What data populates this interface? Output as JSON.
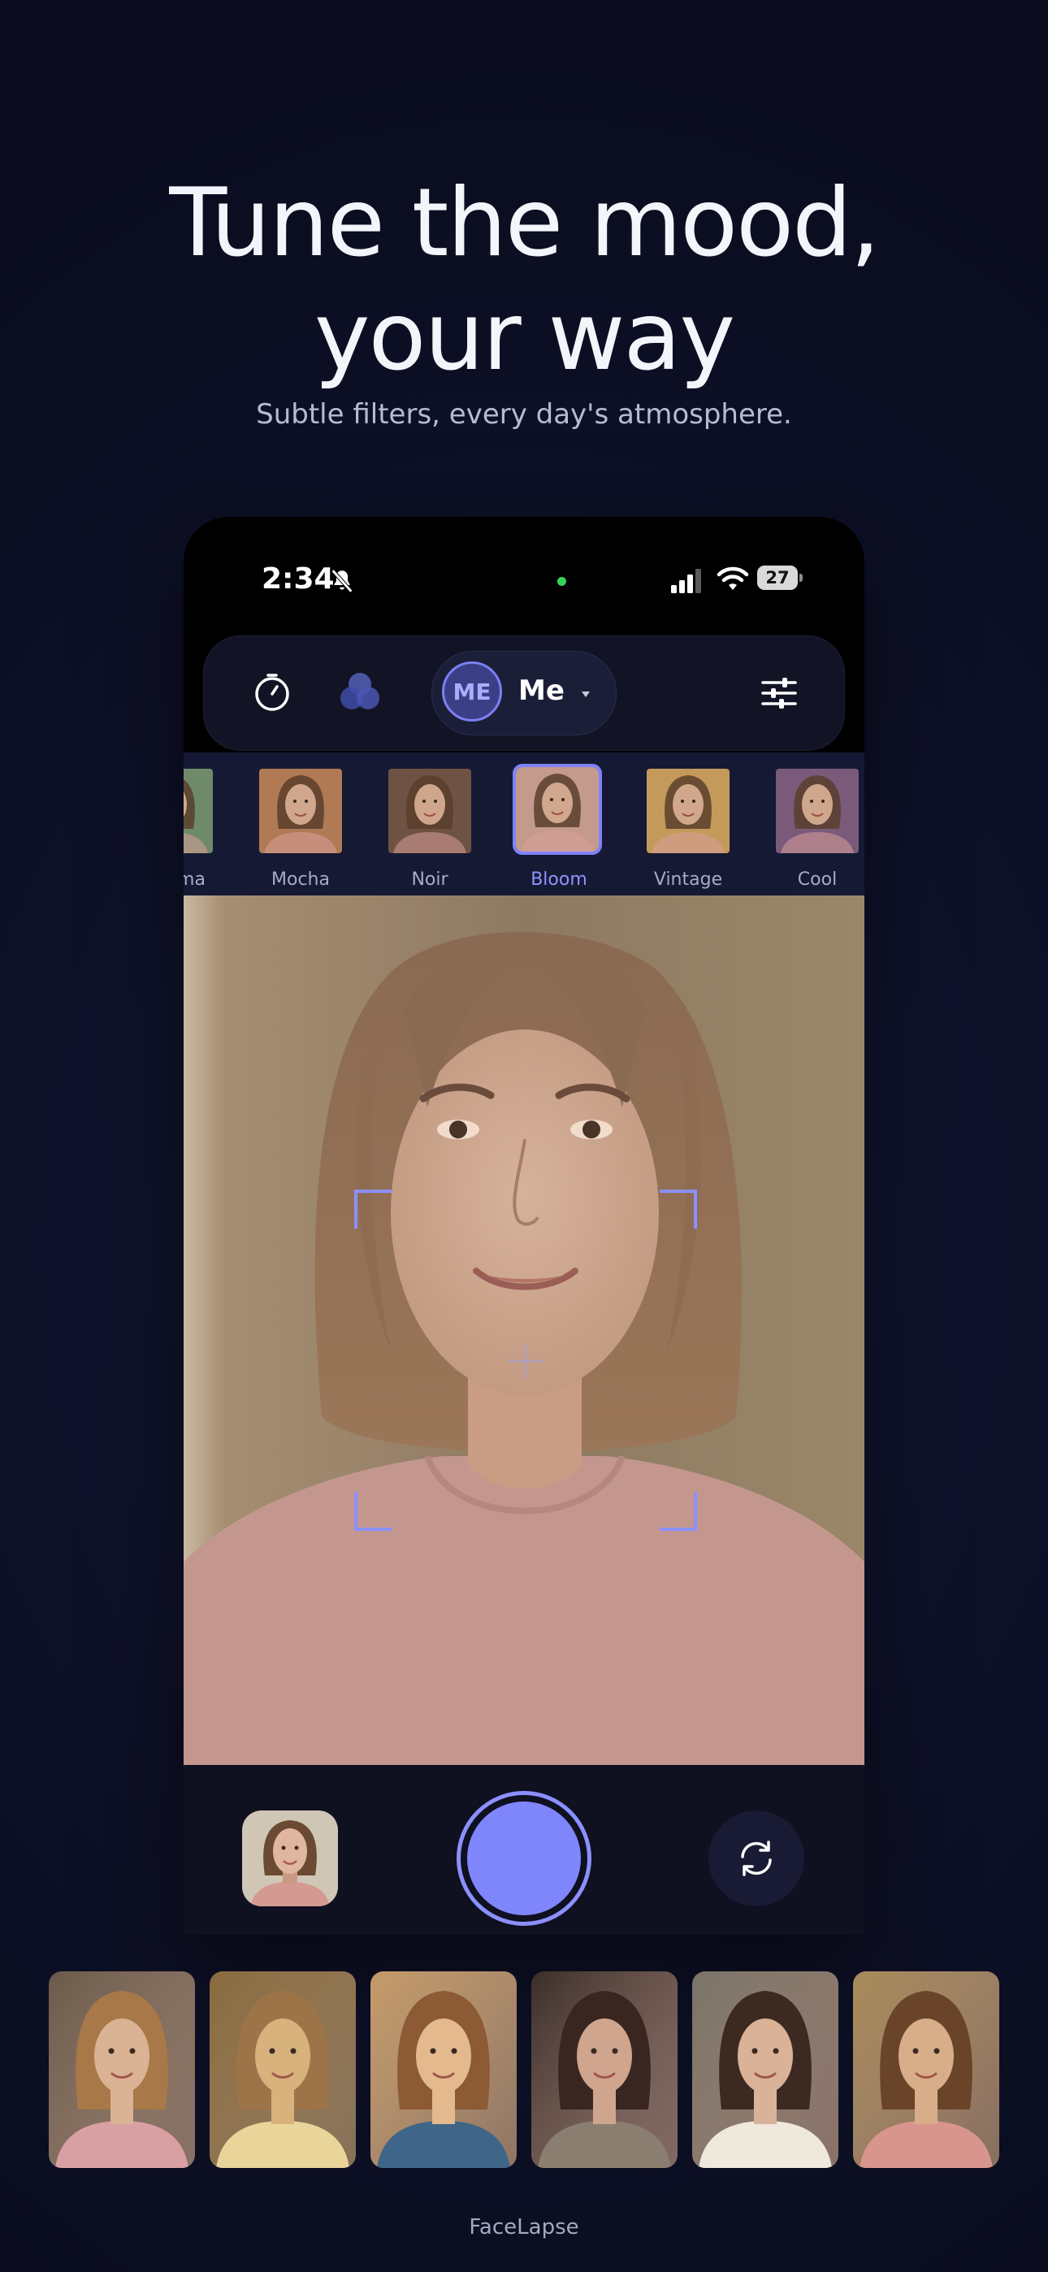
{
  "headline": {
    "line1": "Tune the mood,",
    "line2": "your way"
  },
  "subheadline": "Subtle filters, every day's atmosphere.",
  "status_bar": {
    "time": "2:34",
    "battery": "27",
    "icons": [
      "bell-off-icon",
      "signal-icon",
      "wifi-icon",
      "battery-icon"
    ]
  },
  "toolbar": {
    "timer_icon": "timer-icon",
    "filter_icon": "color-filter-icon",
    "profile": {
      "avatar_initials": "ME",
      "name": "Me"
    },
    "settings_icon": "sliders-icon"
  },
  "filters": {
    "selected": "Bloom",
    "items": [
      {
        "label": "Cinema",
        "tint": "#6f8a6a"
      },
      {
        "label": "Mocha",
        "tint": "#b07a55"
      },
      {
        "label": "Noir",
        "tint": "#6e5243"
      },
      {
        "label": "Bloom",
        "tint": "#c49a8c"
      },
      {
        "label": "Vintage",
        "tint": "#c49a5a"
      },
      {
        "label": "Cool",
        "tint": "#7a5a7a"
      }
    ]
  },
  "preview": {
    "focus_icon": "crosshair-icon"
  },
  "capture": {
    "last_shot_icon": "thumbnail",
    "shutter_icon": "shutter-icon",
    "flip_icon": "flip-camera-icon",
    "accent": "#7f86fb"
  },
  "gallery": [
    {
      "top": "#d9b393",
      "bg": "#6a5a4a",
      "hair": "#a87848",
      "shirt": "#d9a0a4"
    },
    {
      "top": "#d7b27c",
      "bg": "#8a6a3e",
      "hair": "#9c7448",
      "shirt": "#e9d49a"
    },
    {
      "top": "#e4b98e",
      "bg": "#c49a6a",
      "hair": "#8c5a34",
      "shirt": "#3f6688"
    },
    {
      "top": "#cfa58e",
      "bg": "#3a2e28",
      "hair": "#3a2620",
      "shirt": "#8a7e70"
    },
    {
      "top": "#d9b297",
      "bg": "#7a7468",
      "hair": "#3c2a22",
      "shirt": "#efe8dc"
    },
    {
      "top": "#d8ae8a",
      "bg": "#a88a5a",
      "hair": "#6a4428",
      "shirt": "#d8958e"
    }
  ],
  "footer": {
    "brand": "FaceLapse"
  },
  "colors": {
    "background": "#0e1128",
    "accent": "#7f86fb",
    "selected_label": "#8f94ff"
  }
}
